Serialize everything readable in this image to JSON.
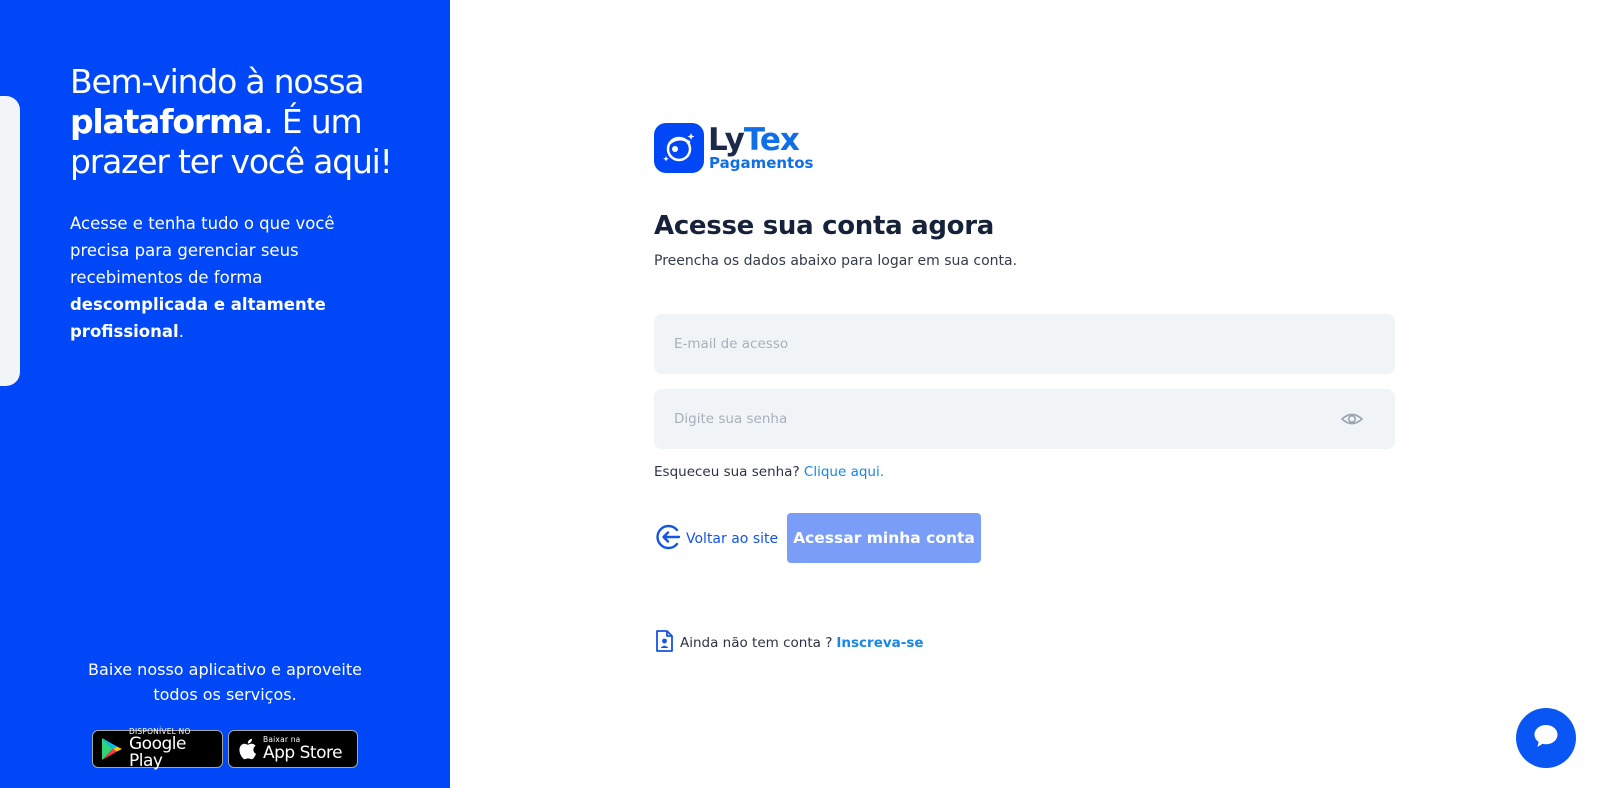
{
  "left_panel": {
    "headline_part1": "Bem-vindo à nossa ",
    "headline_bold": "plataforma",
    "headline_part2": ". É um prazer ter você aqui!",
    "subtext_part1": "Acesse e tenha tudo o que você precisa para gerenciar seus recebimentos de forma ",
    "subtext_bold": "descomplicada e altamente profissional",
    "subtext_part2": ".",
    "download_text": "Baixe nosso aplicativo e aproveite todos os serviços.",
    "google_play": {
      "small": "DISPONÍVEL NO",
      "big": "Google Play"
    },
    "app_store": {
      "small": "Baixar na",
      "big": "App Store"
    }
  },
  "logo": {
    "name_part1": "Ly",
    "name_part2": "Tex",
    "sub": "Pagamentos"
  },
  "form": {
    "title": "Acesse sua conta agora",
    "subtitle": "Preencha os dados abaixo para logar em sua conta.",
    "email_placeholder": "E-mail de acesso",
    "password_placeholder": "Digite sua senha",
    "forgot_text": "Esqueceu sua senha?",
    "forgot_link": "Clique aqui.",
    "back_label": "Voltar ao site",
    "submit_label": "Acessar minha conta",
    "signup_text": "Ainda não tem conta ?",
    "signup_link": "Inscreva-se"
  },
  "colors": {
    "brand_blue": "#0047f7",
    "link_blue": "#1786e8",
    "button_disabled": "#7a9ef8",
    "field_bg": "#f0f4f7"
  },
  "icons": [
    "google-play-icon",
    "apple-icon",
    "rocket-logo-icon",
    "eye-icon",
    "back-arrow-icon",
    "document-user-icon",
    "chat-icon"
  ]
}
